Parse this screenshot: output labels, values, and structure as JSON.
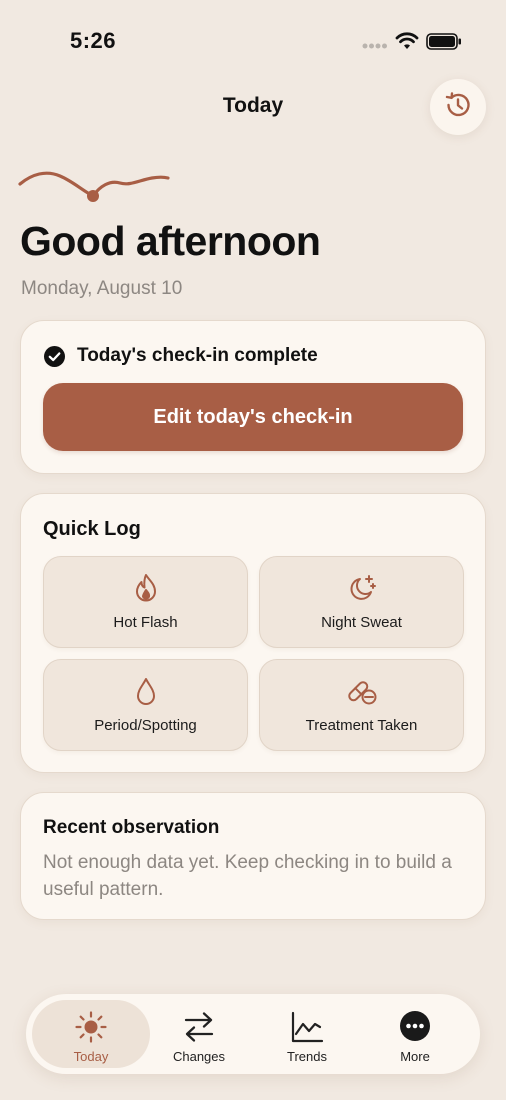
{
  "status_bar": {
    "time": "5:26"
  },
  "header": {
    "title": "Today"
  },
  "greeting": {
    "title": "Good afternoon",
    "date": "Monday, August 10"
  },
  "checkin": {
    "status": "Today's check-in complete",
    "edit_label": "Edit today's check-in"
  },
  "quick_log": {
    "title": "Quick Log",
    "items": [
      {
        "label": "Hot Flash",
        "icon": "flame-icon"
      },
      {
        "label": "Night Sweat",
        "icon": "moon-stars-icon"
      },
      {
        "label": "Period/Spotting",
        "icon": "droplet-icon"
      },
      {
        "label": "Treatment Taken",
        "icon": "pills-icon"
      }
    ]
  },
  "observation": {
    "title": "Recent observation",
    "body": "Not enough data yet. Keep checking in to build a useful pattern."
  },
  "tabs": [
    {
      "label": "Today",
      "icon": "sun-icon",
      "active": true
    },
    {
      "label": "Changes",
      "icon": "arrows-swap-icon",
      "active": false
    },
    {
      "label": "Trends",
      "icon": "chart-line-icon",
      "active": false
    },
    {
      "label": "More",
      "icon": "more-dots-icon",
      "active": false
    }
  ],
  "colors": {
    "background": "#f1e9e1",
    "accent": "#a85e45",
    "card": "#fcf7f1",
    "tile": "#f0e6dc",
    "muted_text": "#8d8782"
  }
}
